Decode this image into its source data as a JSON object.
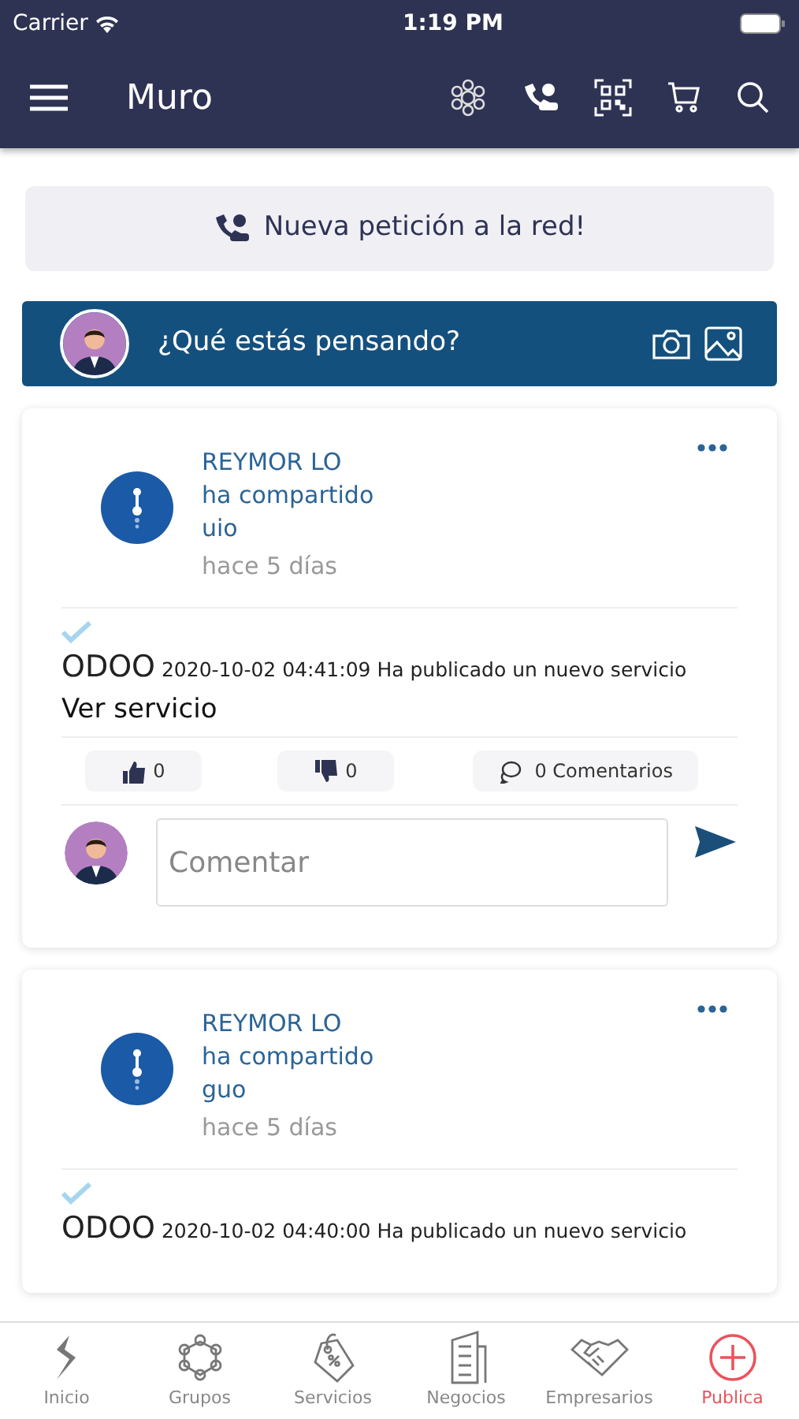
{
  "status_bar": {
    "carrier": "Carrier",
    "time": "1:19 PM"
  },
  "header": {
    "title": "Muro"
  },
  "request_button": {
    "label": "Nueva petición a la red!"
  },
  "composer": {
    "placeholder": "¿Qué estás pensando?"
  },
  "posts": [
    {
      "author": "REYMOR LO",
      "action": "ha compartido",
      "target": "uio",
      "time": "hace 5 días",
      "verified": true,
      "source": "ODOO",
      "timestamp": "2020-10-02 04:41:09",
      "message": "Ha publicado un nuevo servicio",
      "link": "Ver servicio",
      "likes": "0",
      "dislikes": "0",
      "comments": "0 Comentarios",
      "comment_placeholder": "Comentar"
    },
    {
      "author": "REYMOR LO",
      "action": "ha compartido",
      "target": "guo",
      "time": "hace 5 días",
      "verified": true,
      "source": "ODOO",
      "timestamp": "2020-10-02 04:40:00",
      "message": "Ha publicado un nuevo servicio"
    }
  ],
  "tab_bar": [
    {
      "label": "Inicio",
      "kind": "logo",
      "selected": false
    },
    {
      "label": "Grupos",
      "kind": "network",
      "selected": false
    },
    {
      "label": "Servicios",
      "kind": "tag",
      "selected": false
    },
    {
      "label": "Negocios",
      "kind": "building",
      "selected": false
    },
    {
      "label": "Empresarios",
      "kind": "handshake",
      "selected": false
    },
    {
      "label": "Publica",
      "kind": "plus",
      "selected": true
    }
  ]
}
